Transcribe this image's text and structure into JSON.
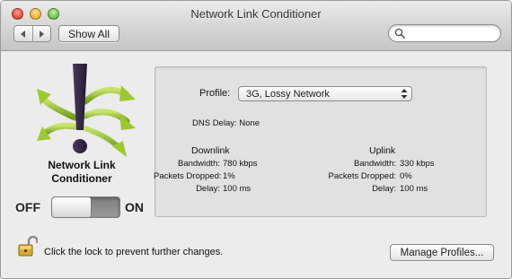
{
  "window": {
    "title": "Network Link Conditioner"
  },
  "toolbar": {
    "back_icon": "chevron-left-icon",
    "forward_icon": "chevron-right-icon",
    "show_all_label": "Show All",
    "search": {
      "value": "",
      "placeholder": ""
    }
  },
  "app": {
    "name_line1": "Network Link",
    "name_line2": "Conditioner",
    "logo_icon": "exclamation-arrows-icon",
    "switch": {
      "off_label": "OFF",
      "on_label": "ON",
      "state": "off"
    }
  },
  "settings": {
    "profile_label": "Profile:",
    "profile_value": "3G, Lossy Network",
    "dns_delay": "DNS Delay: None",
    "downlink": {
      "title": "Downlink",
      "bandwidth_label": "Bandwidth:",
      "bandwidth_value": "780 kbps",
      "packets_label": "Packets Dropped:",
      "packets_value": "1%",
      "delay_label": "Delay:",
      "delay_value": "100 ms"
    },
    "uplink": {
      "title": "Uplink",
      "bandwidth_label": "Bandwidth:",
      "bandwidth_value": "330 kbps",
      "packets_label": "Packets Dropped:",
      "packets_value": "0%",
      "delay_label": "Delay:",
      "delay_value": "100 ms"
    }
  },
  "footer": {
    "lock_icon": "unlocked-padlock-icon",
    "lock_text": "Click the lock to prevent further changes.",
    "manage_label": "Manage Profiles..."
  },
  "colors": {
    "logo_green": "#8cbf2a",
    "logo_dark": "#3a2a4a"
  }
}
